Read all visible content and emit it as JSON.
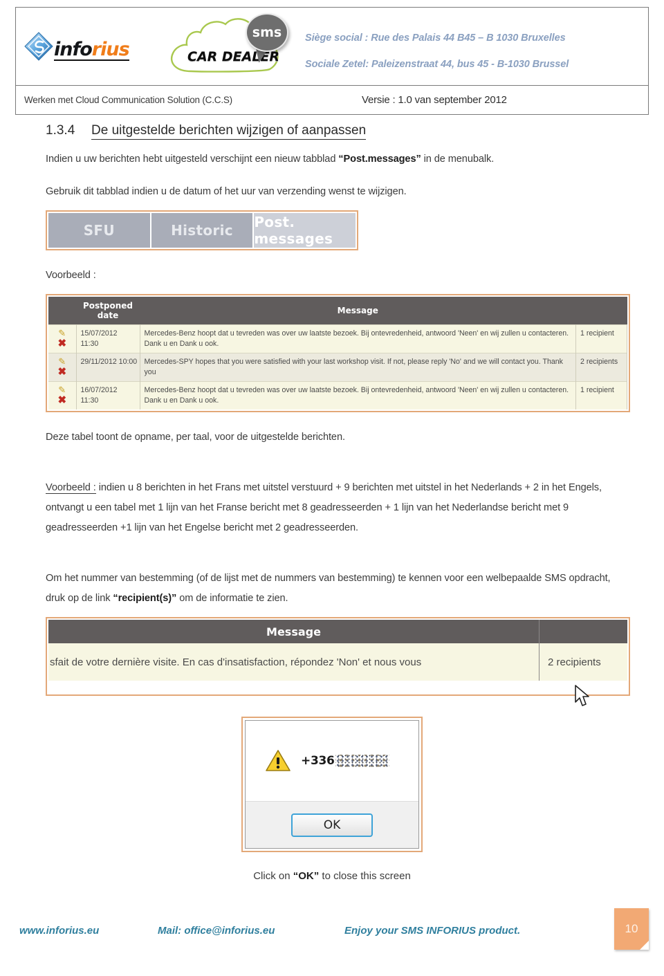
{
  "header": {
    "brand_part1": "info",
    "brand_part2": "rius",
    "cloud_label": "CAR DEALER",
    "sms_label": "sms",
    "address_fr": "Siège social : Rue des Palais 44 B45 – B 1030 Bruxelles",
    "address_nl": "Sociale Zetel: Paleizenstraat 44, bus 45 - B-1030 Brussel",
    "subject": "Werken met Cloud Communication Solution (C.C.S)",
    "version": "Versie : 1.0 van september 2012"
  },
  "section": {
    "number": "1.3.4",
    "title": "De uitgestelde berichten wijzigen of aanpassen",
    "intro_a": "Indien u uw berichten hebt uitgesteld verschijnt een nieuw tabblad ",
    "intro_bold": "“Post.messages”",
    "intro_b": " in de menubalk.",
    "intro2": "Gebruik dit tabblad indien u de datum of het uur van verzending wenst te wijzigen.",
    "example_label": "Voorbeeld :",
    "caption_table": "Deze tabel toont de opname, per taal, voor de uitgestelde berichten.",
    "example2_label": "Voorbeeld :",
    "example2_text": " indien u 8 berichten in het Frans met uitstel verstuurd + 9 berichten met uitstel in het Nederlands + 2 in het Engels, ontvangt u een tabel met 1 lijn van het Franse bericht met 8 geadresseerden + 1 lijn van het Nederlandse bericht met 9 geadresseerden +1 lijn van het Engelse bericht met 2 geadresseerden.",
    "recipients_a": "Om het nummer van bestemming (of de lijst met de nummers van bestemming) te kennen voor een welbepaalde SMS opdracht, druk op de link ",
    "recipients_bold": "“recipient(s)”",
    "recipients_b": "  om de informatie te zien."
  },
  "tabs_screenshot": {
    "tabs": [
      {
        "label": "SFU",
        "active": false
      },
      {
        "label": "Historic",
        "active": false
      },
      {
        "label": "Post. messages",
        "active": true
      }
    ]
  },
  "postponed_table": {
    "headers": [
      "",
      "Postponed date",
      "Message",
      ""
    ],
    "rows": [
      {
        "date": "15/07/2012 11:30",
        "message": "Mercedes-Benz hoopt dat u tevreden was over uw laatste bezoek. Bij ontevredenheid, antwoord 'Neen' en wij zullen u contacteren. Dank u en Dank u ook.",
        "recipients": "1 recipient"
      },
      {
        "date": "29/11/2012 10:00",
        "message": "Mercedes-SPY hopes that you were satisfied with your last workshop visit. If not, please reply 'No' and we will contact you. Thank you",
        "recipients": "2 recipients"
      },
      {
        "date": "16/07/2012 11:30",
        "message": "Mercedes-Benz hoopt dat u tevreden was over uw laatste bezoek. Bij ontevredenheid, antwoord 'Neen' en wij zullen u contacteren. Dank u en Dank u ook.",
        "recipients": "1 recipient"
      }
    ],
    "edit_icon": "pencil-icon",
    "delete_icon": "red-x-icon"
  },
  "recipients_screenshot": {
    "header_message": "Message",
    "message_text": "sfait de votre dernière visite. En cas d'insatisfaction, répondez 'Non' et nous vous",
    "recipients": "2 recipients",
    "cursor": "mouse-pointer"
  },
  "dialog": {
    "icon": "warning-triangle-icon",
    "number": "+336",
    "ok_label": "OK",
    "caption_a": "Click on ",
    "caption_bold": "“OK”",
    "caption_b": " to close this screen"
  },
  "footer": {
    "website": "www.inforius.eu",
    "mail": "Mail: office@inforius.eu",
    "slogan": "Enjoy your SMS INFORIUS product.",
    "page_number": "10"
  },
  "colors": {
    "accent_orange": "#e3a878",
    "brand_orange": "#f07d1a",
    "table_header": "#605c5c",
    "table_row": "#f7f6e2",
    "footer_link": "#2f7f9e",
    "address_blue": "#8aa0c0",
    "cloud_green": "#a9c84e"
  }
}
